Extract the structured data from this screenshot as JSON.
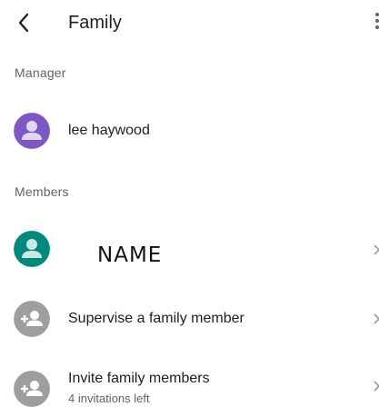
{
  "app_bar": {
    "title": "Family",
    "back_icon": "arrow-back-icon",
    "more_icon": "more-vert-icon"
  },
  "manager_section": {
    "header": "Manager",
    "member": {
      "name": "lee haywood",
      "avatar_color": "#7e57c2"
    }
  },
  "members_section": {
    "header": "Members",
    "member": {
      "name": "NAME",
      "avatar_color": "#00897b"
    },
    "actions": [
      {
        "label": "Supervise a family member",
        "icon": "person-add-icon"
      },
      {
        "label": "Invite family members",
        "sublabel": "4 invitations left",
        "icon": "person-add-icon"
      }
    ]
  },
  "colors": {
    "text_primary": "#202124",
    "text_secondary": "#5f6368",
    "action_avatar": "#9e9e9e"
  }
}
